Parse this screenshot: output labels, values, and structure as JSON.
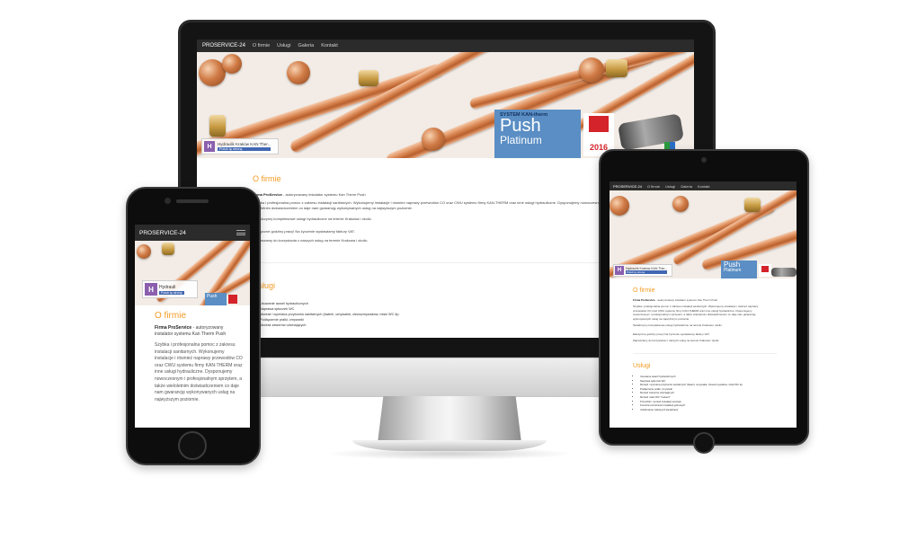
{
  "site": {
    "brand": "PROSERVICE-24",
    "nav": [
      "O firmie",
      "Usługi",
      "Galeria",
      "Kontakt"
    ],
    "fb_name": "Hydraulik Kraków KAN Ther...",
    "fb_like": "Polub tę stronę",
    "fb_letter": "H",
    "promo_system": "SYSTEM KAN-therm",
    "promo_push": "Push",
    "promo_platinum": "Platinum",
    "promo_year": "2016",
    "promo_small": "Push\nPlatinum",
    "about_heading": "O firmie",
    "about_company": "Firma ProService",
    "about_intro": " - autoryzowany instalator systemu Kan Therm Push",
    "about_p1_full": "Szybka i profesjonalna pomoc z zakresu instalacji sanitarnych. Wykonujemy instalacje i również naprawy przewodów CO oraz CWU systemu firmy KAN-THERM oraz inne usługi hydrauliczne. Dysponujemy nowoczesnym i profesjonalnym sprzętem, a także wieloletnim doświadczeniem co daje nam gwarancję wykonywanych usług na najwyższym poziomie.",
    "about_p2": "Świadczymy kompleksowe usługi hydrauliczne na terenie Krakowa i okolic.",
    "about_p3": "Elastyczne godziny pracy! Na życzenie wystawiamy faktury VAT.",
    "about_p4": "Zapraszamy do korzystania z naszych usług na terenie Krakowa i okolic.",
    "services_heading": "Usługi",
    "services": [
      "Usuwanie awarii hydraulicznych",
      "Naprawa spłuczek WC",
      "Montaż i wymiana przyborów sanitarnych (baterii, umywalek, zlewozmywaków, miski WC itp.",
      "Podłączenie pralki, zmywarki",
      "Montaż zaworów odcinających",
      "Montaż miski WC \"Geberit\"",
      "Przeróbki i montaż instalacji wod-kan",
      "Kontrola szczelności instalacji gazowych",
      "Udrażnianie zatkanych kanalizacji"
    ],
    "phone_heading": "O firmie",
    "phone_company": "Firma ProService",
    "phone_intro": " - autoryzowany instalator systemu Kan Therm Push",
    "phone_p1": "Szybka i profesjonalna pomoc z zakresu instalacji sanitarnych. Wykonujemy instalacje i również naprawy przewodów CO oraz CWU systemu firmy KAN-THERM oraz inne usługi hydrauliczne. Dysponujemy nowoczesnym i profesjonalnym sprzętem, a także wieloletnim doświadczeniem co daje nam gwarancję wykonywanych usług na najwyższym poziomie.",
    "phone_fb_name": "Hydrauli",
    "phone_fb_like": "Polub tę stronę"
  },
  "colors": {
    "accent": "#f39c24",
    "nav_bg": "#2b2b2b",
    "promo_blue": "#5a8ec4",
    "fb_blue": "#4267b2"
  }
}
